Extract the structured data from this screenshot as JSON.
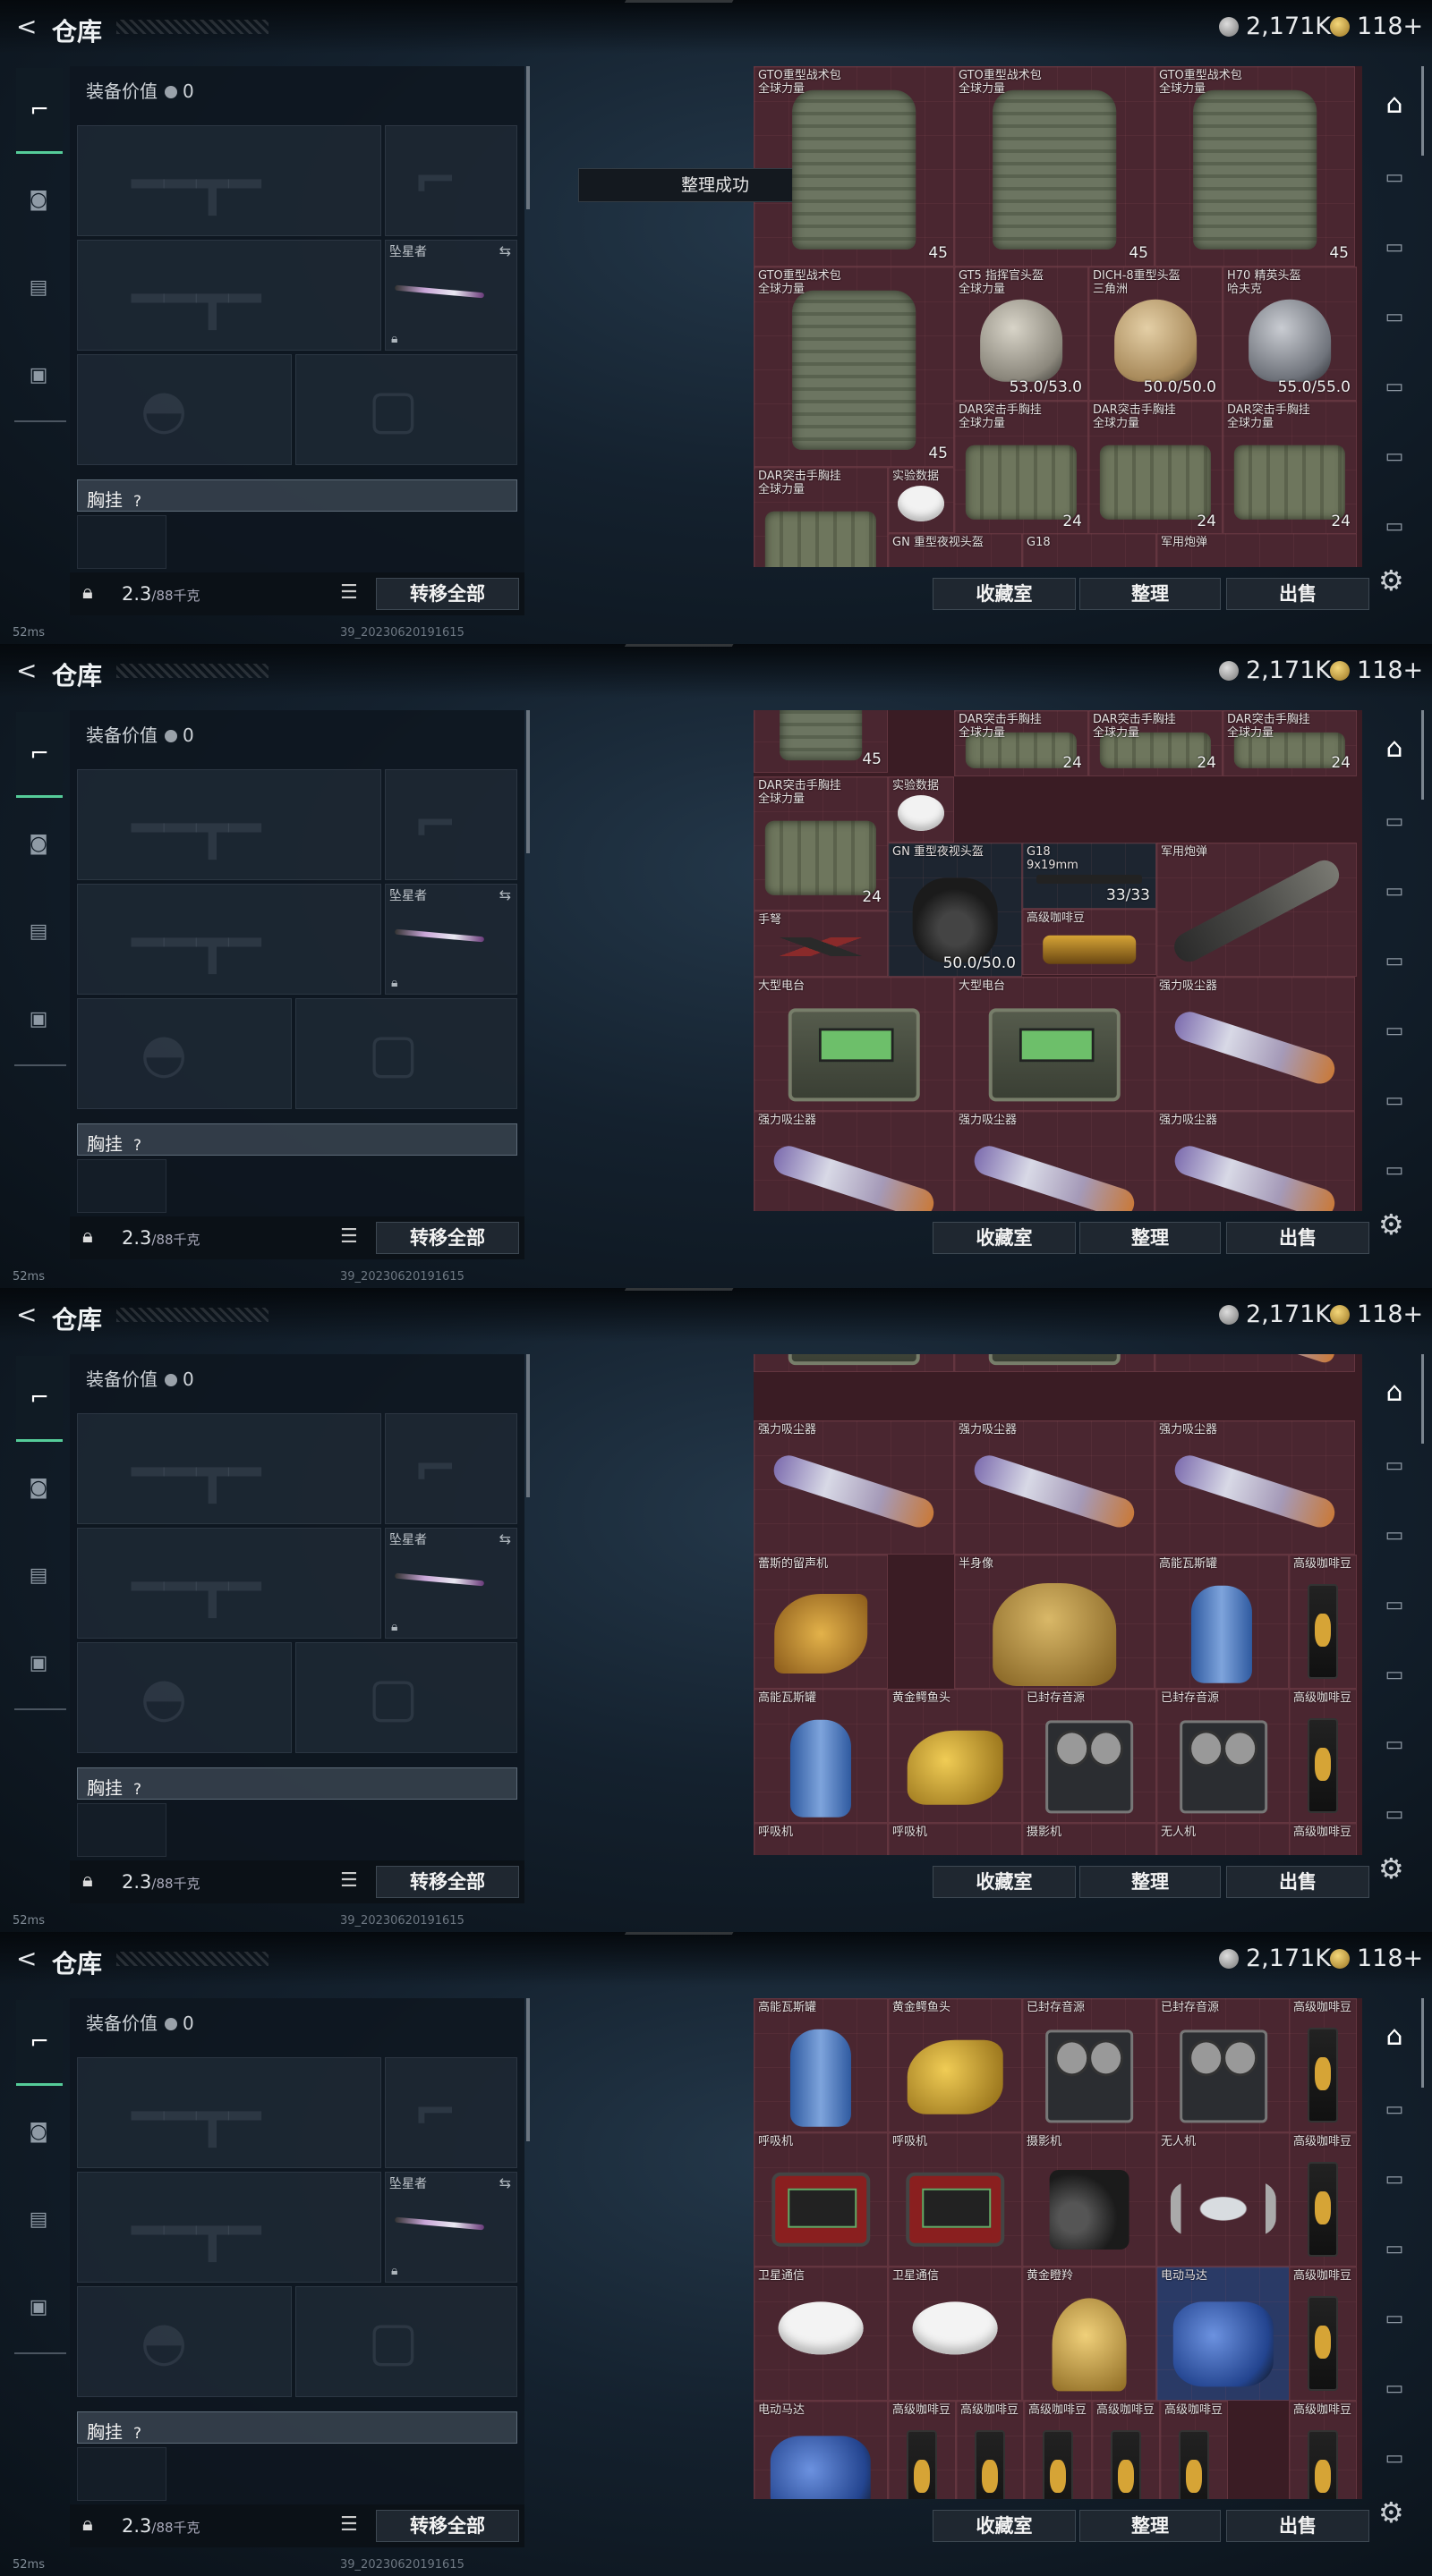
{
  "header": {
    "back_label": "<",
    "title": "仓库",
    "silver_amount": "2,171K",
    "gold_amount": "118+"
  },
  "equipment": {
    "value_label": "装备价值",
    "value": "0",
    "melee_name": "坠星者",
    "chest_label": "胸挂",
    "chest_hint": "?",
    "weight_current": "2.3",
    "weight_max": "/88千克",
    "transfer_all": "转移全部"
  },
  "status": {
    "ping": "52ms",
    "build": "39_20230620191615"
  },
  "toast": "整理成功",
  "buttons": {
    "collection": "收藏室",
    "sort": "整理",
    "sell": "出售"
  },
  "colors": {
    "cell_red": "#4a2630",
    "cell_blue": "#2a3a66",
    "accent_green": "#55cc99"
  },
  "frames": [
    {
      "cells": [
        {
          "name": "GTO重型战术包\n全球力量",
          "icon": "pack",
          "value": "45"
        },
        {
          "name": "GTO重型战术包\n全球力量",
          "icon": "pack",
          "value": "45"
        },
        {
          "name": "GTO重型战术包\n全球力量",
          "icon": "pack",
          "value": "45"
        },
        {
          "name": "GTO重型战术包\n全球力量",
          "icon": "pack",
          "value": "45"
        },
        {
          "name": "GT5 指挥官头盔\n全球力量",
          "icon": "helm",
          "value": "53.0/53.0"
        },
        {
          "name": "DICH-8重型头盔\n三角洲",
          "icon": "helm-tan",
          "value": "50.0/50.0"
        },
        {
          "name": "H70 精英头盔\n哈夫克",
          "icon": "helm-gray",
          "value": "55.0/55.0"
        },
        {
          "name": "DAR突击手胸挂\n全球力量",
          "icon": "rig",
          "value": "24"
        },
        {
          "name": "DAR突击手胸挂\n全球力量",
          "icon": "rig",
          "value": "24"
        },
        {
          "name": "DAR突击手胸挂\n全球力量",
          "icon": "rig",
          "value": "24"
        },
        {
          "name": "DAR突击手胸挂\n全球力量",
          "icon": "rig",
          "value": ""
        },
        {
          "name": "实验数据",
          "icon": "disc",
          "value": ""
        },
        {
          "name": "GN 重型夜视头盔",
          "icon": "",
          "value": ""
        },
        {
          "name": "G18",
          "icon": "",
          "value": ""
        },
        {
          "name": "军用炮弹",
          "icon": "",
          "value": ""
        }
      ]
    },
    {
      "cells": [
        {
          "name": "",
          "icon": "pack",
          "value": "45"
        },
        {
          "name": "DAR突击手胸挂\n全球力量",
          "icon": "rig",
          "value": "24"
        },
        {
          "name": "DAR突击手胸挂\n全球力量",
          "icon": "rig",
          "value": "24"
        },
        {
          "name": "DAR突击手胸挂\n全球力量",
          "icon": "rig",
          "value": "24"
        },
        {
          "name": "DAR突击手胸挂\n全球力量",
          "icon": "rig",
          "value": "24"
        },
        {
          "name": "实验数据",
          "icon": "disc",
          "value": ""
        },
        {
          "name": "GN 重型夜视头盔",
          "icon": "nvg",
          "value": "50.0/50.0"
        },
        {
          "name": "G18\n9x19mm",
          "icon": "gun",
          "value": "33/33"
        },
        {
          "name": "手弩",
          "icon": "cross",
          "value": ""
        },
        {
          "name": "高级咖啡豆",
          "icon": "beans",
          "value": ""
        },
        {
          "name": "军用炮弹",
          "icon": "rocket",
          "value": ""
        },
        {
          "name": "大型电台",
          "icon": "radio",
          "value": ""
        },
        {
          "name": "大型电台",
          "icon": "radio",
          "value": ""
        },
        {
          "name": "强力吸尘器",
          "icon": "vac",
          "value": ""
        },
        {
          "name": "强力吸尘器",
          "icon": "vac",
          "value": ""
        },
        {
          "name": "强力吸尘器",
          "icon": "vac",
          "value": ""
        },
        {
          "name": "强力吸尘器",
          "icon": "vac",
          "value": ""
        }
      ]
    },
    {
      "cells": [
        {
          "name": "",
          "icon": "radio",
          "value": ""
        },
        {
          "name": "",
          "icon": "radio",
          "value": ""
        },
        {
          "name": "",
          "icon": "vac",
          "value": ""
        },
        {
          "name": "强力吸尘器",
          "icon": "vac",
          "value": ""
        },
        {
          "name": "强力吸尘器",
          "icon": "vac",
          "value": ""
        },
        {
          "name": "强力吸尘器",
          "icon": "vac",
          "value": ""
        },
        {
          "name": "蕾斯的留声机",
          "icon": "phono",
          "value": ""
        },
        {
          "name": "半身像",
          "icon": "bust",
          "value": ""
        },
        {
          "name": "高能瓦斯罐",
          "icon": "tank",
          "value": ""
        },
        {
          "name": "高级咖啡豆",
          "icon": "coffee",
          "value": ""
        },
        {
          "name": "高能瓦斯罐",
          "icon": "tank",
          "value": ""
        },
        {
          "name": "黄金鳄鱼头",
          "icon": "croc",
          "value": ""
        },
        {
          "name": "已封存音源",
          "icon": "reel",
          "value": ""
        },
        {
          "name": "已封存音源",
          "icon": "reel",
          "value": ""
        },
        {
          "name": "高级咖啡豆",
          "icon": "coffee",
          "value": ""
        },
        {
          "name": "呼吸机",
          "icon": "",
          "value": ""
        },
        {
          "name": "呼吸机",
          "icon": "",
          "value": ""
        },
        {
          "name": "摄影机",
          "icon": "",
          "value": ""
        },
        {
          "name": "无人机",
          "icon": "",
          "value": ""
        },
        {
          "name": "高级咖啡豆",
          "icon": "",
          "value": ""
        }
      ]
    },
    {
      "cells": [
        {
          "name": "高能瓦斯罐",
          "icon": "tank",
          "value": ""
        },
        {
          "name": "黄金鳄鱼头",
          "icon": "croc",
          "value": ""
        },
        {
          "name": "已封存音源",
          "icon": "reel",
          "value": ""
        },
        {
          "name": "已封存音源",
          "icon": "reel",
          "value": ""
        },
        {
          "name": "高级咖啡豆",
          "icon": "coffee",
          "value": ""
        },
        {
          "name": "呼吸机",
          "icon": "resp",
          "value": ""
        },
        {
          "name": "呼吸机",
          "icon": "resp",
          "value": ""
        },
        {
          "name": "摄影机",
          "icon": "cam",
          "value": ""
        },
        {
          "name": "无人机",
          "icon": "drone",
          "value": ""
        },
        {
          "name": "高级咖啡豆",
          "icon": "coffee",
          "value": ""
        },
        {
          "name": "卫星通信",
          "icon": "dish",
          "value": ""
        },
        {
          "name": "卫星通信",
          "icon": "dish",
          "value": ""
        },
        {
          "name": "黄金瞪羚",
          "icon": "deer",
          "value": ""
        },
        {
          "name": "电动马达",
          "icon": "motor",
          "value": ""
        },
        {
          "name": "高级咖啡豆",
          "icon": "coffee",
          "value": ""
        },
        {
          "name": "电动马达",
          "icon": "motor",
          "value": ""
        },
        {
          "name": "高级咖啡豆",
          "icon": "coffee",
          "value": ""
        },
        {
          "name": "高级咖啡豆",
          "icon": "coffee",
          "value": ""
        },
        {
          "name": "高级咖啡豆",
          "icon": "coffee",
          "value": ""
        },
        {
          "name": "高级咖啡豆",
          "icon": "coffee",
          "value": ""
        },
        {
          "name": "高级咖啡豆",
          "icon": "coffee",
          "value": ""
        },
        {
          "name": "高级咖啡豆",
          "icon": "coffee",
          "value": ""
        }
      ]
    }
  ]
}
